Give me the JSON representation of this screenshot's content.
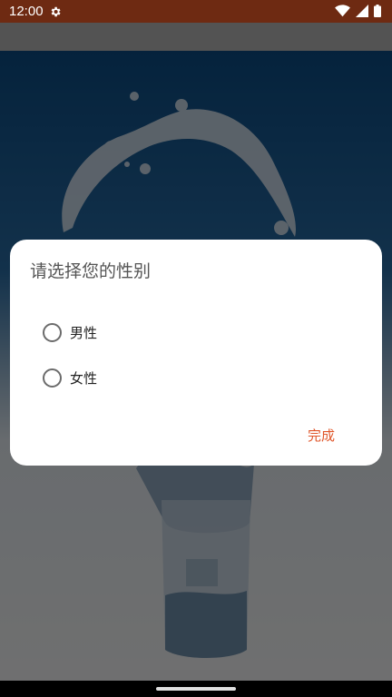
{
  "status_bar": {
    "time": "12:00",
    "icons": [
      "gear-icon",
      "wifi-icon",
      "signal-icon",
      "battery-icon"
    ]
  },
  "dialog": {
    "title": "请选择您的性别",
    "options": [
      {
        "label": "男性",
        "selected": false
      },
      {
        "label": "女性",
        "selected": false
      }
    ],
    "done_label": "完成",
    "accent_color": "#e0562a"
  },
  "colors": {
    "status_bar": "#6e2a12",
    "scrim": "rgba(0,0,0,0.55)"
  }
}
